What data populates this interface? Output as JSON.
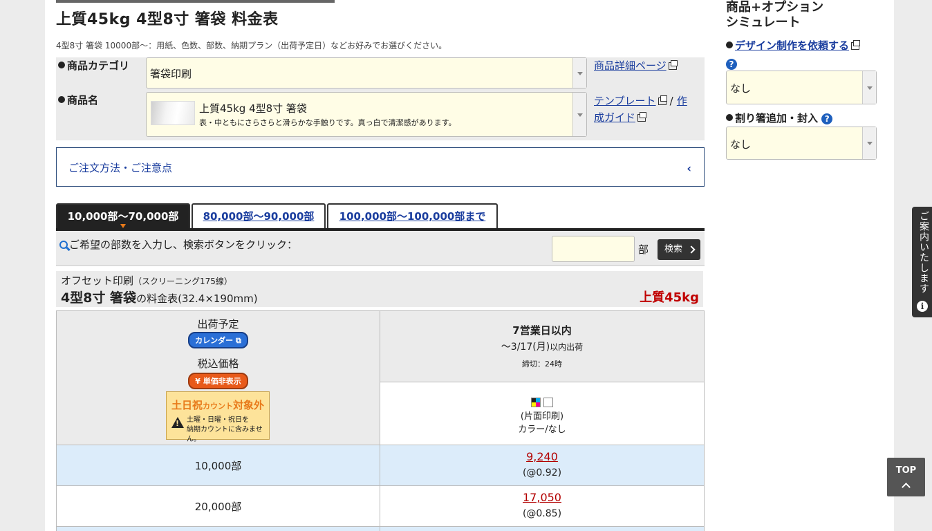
{
  "header": {
    "title": "上質45kg 4型8寸 箸袋 料金表",
    "subtitle": "4型8寸 箸袋 10000部〜：用紙、色数、部数、納期プラン（出荷予定日）などお好みでお選びください。"
  },
  "selectors": {
    "category_label": "商品カテゴリ",
    "category_value": "箸袋印刷",
    "detail_link": "商品詳細ページ",
    "product_label": "商品名",
    "product_name": "上質45kg 4型8寸 箸袋",
    "product_desc": "表・中ともにさらさらと滑らかな手触りです。真っ白で清潔感があります。",
    "template_link": "テンプレート",
    "slash": "/",
    "guide_link_1": "作",
    "guide_link_2": "成ガイド"
  },
  "accordion": {
    "label": "ご注文方法・ご注意点"
  },
  "tabs": [
    {
      "label": "10,000部〜70,000部",
      "active": true
    },
    {
      "label": "80,000部〜90,000部",
      "active": false
    },
    {
      "label": "100,000部〜100,000部まで",
      "active": false
    }
  ],
  "search": {
    "label": "ご希望の部数を入力し、検索ボタンをクリック：",
    "unit": "部",
    "button": "検索",
    "value": ""
  },
  "price_table": {
    "method": "オフセット印刷",
    "screening": "（スクリーニング175線）",
    "size_title": "4型8寸 箸袋",
    "size_suffix": "の料金表(32.4×190mm)",
    "paper": "上質45kg",
    "ship_label": "出荷予定",
    "calendar_btn": "カレンダー",
    "tax_label": "税込価格",
    "unit_price_btn": "単価非表示",
    "weekend_title_a": "土日祝",
    "weekend_title_b": "カウント",
    "weekend_title_c": "対象外",
    "weekend_desc_1": "土曜・日曜・祝日を",
    "weekend_desc_2": "納期カウントに含みません。",
    "plan_title": "7営業日以内",
    "plan_ship_date": "〜3/17(月)",
    "plan_ship_suffix": "以内出荷",
    "plan_cutoff": "締切：24時",
    "print_side": "(片面印刷)",
    "print_colors": "カラー/なし",
    "rows": [
      {
        "qty": "10,000部",
        "price": "9,240",
        "unit": "(@0.92)"
      },
      {
        "qty": "20,000部",
        "price": "17,050",
        "unit": "(@0.85)"
      }
    ]
  },
  "sidebar": {
    "title_1": "商品+オプション",
    "title_2": "シミュレート",
    "design_link": "デザイン制作を依頼する",
    "design_value": "なし",
    "chopstick_label": "割り箸追加・封入",
    "chopstick_value": "なし"
  },
  "floating": {
    "guide_text": "ご案内いたします",
    "top_label": "TOP"
  },
  "colors": {
    "accent_blue": "#1a3d9e",
    "price_red": "#b30000",
    "select_bg": "#fffde6",
    "row_highlight": "#dcecfa"
  }
}
